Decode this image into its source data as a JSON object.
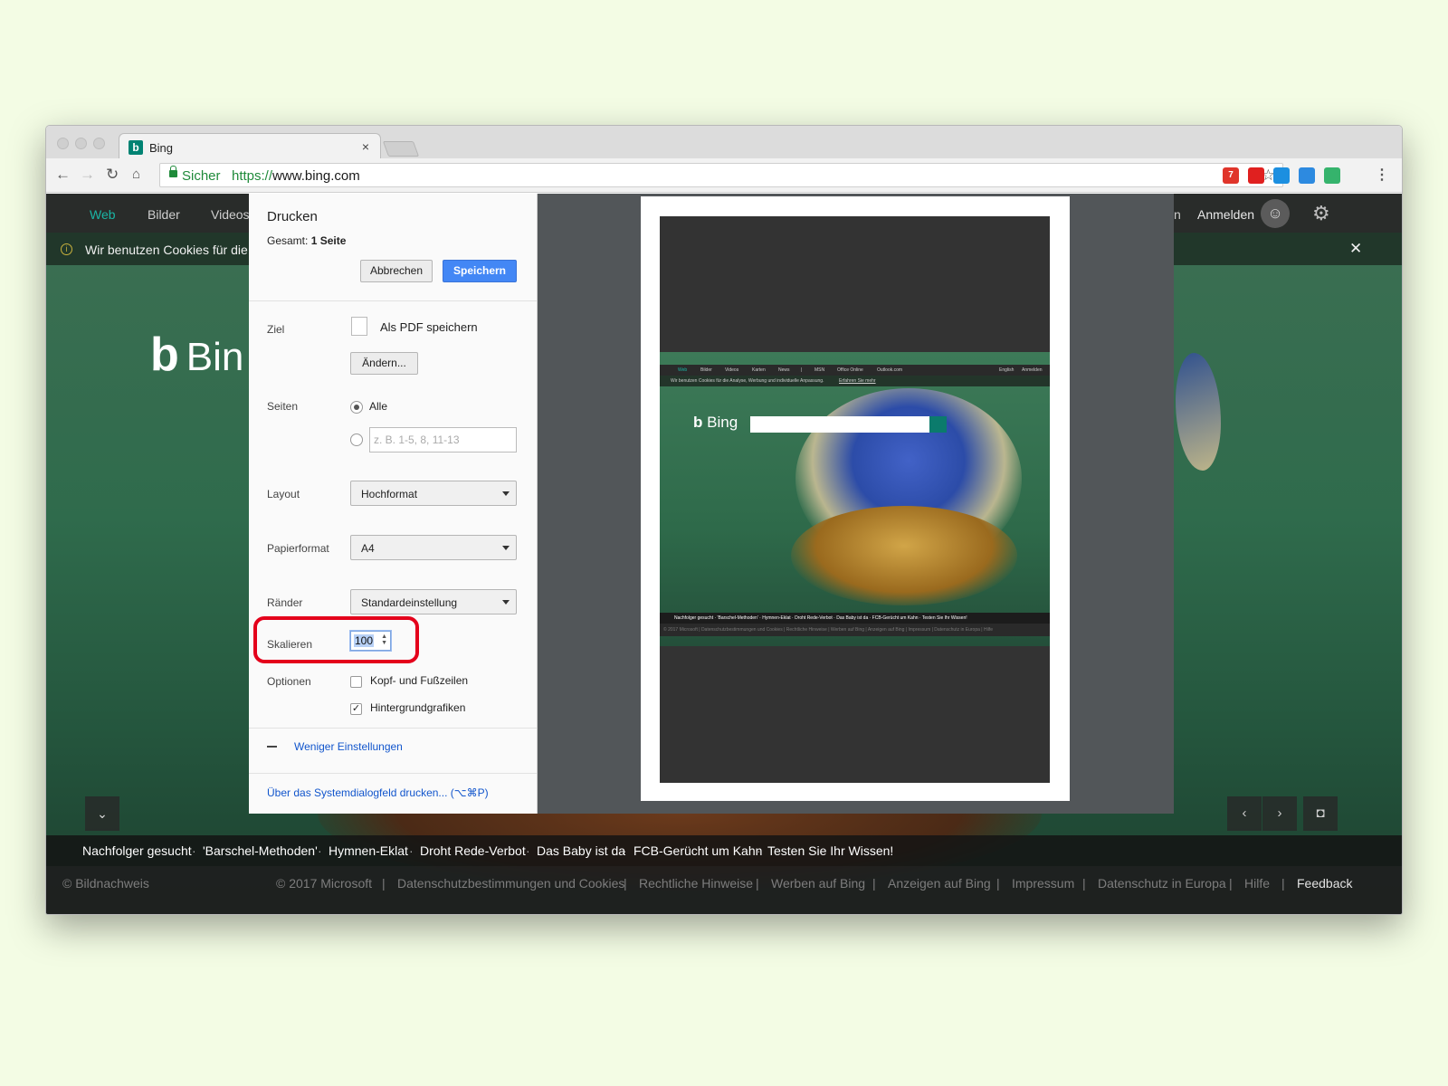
{
  "browser": {
    "tab_title": "Bing",
    "tab_close": "×",
    "secure_label": "Sicher",
    "url_scheme": "https://",
    "url_rest": "www.bing.com",
    "extensions": [
      {
        "name": "calendar-extension-icon",
        "color": "#e0352b",
        "badge": "7"
      },
      {
        "name": "opera-extension-icon",
        "color": "#e0201f"
      },
      {
        "name": "skype-extension-icon",
        "color": "#1c8fe0"
      },
      {
        "name": "plus-extension-icon",
        "color": "#2d8ae0"
      },
      {
        "name": "green-extension-icon",
        "color": "#35b36c"
      }
    ]
  },
  "bing": {
    "nav": [
      "Web",
      "Bilder",
      "Videos"
    ],
    "nav_right_fragment": "n",
    "signin": "Anmelden",
    "cookie_text": "Wir benutzen Cookies für die A",
    "cookie_close": "✕",
    "logo_text": "Bin",
    "headlines": [
      "Nachfolger gesucht",
      "'Barschel-Methoden'",
      "Hymnen-Eklat",
      "Droht Rede-Verbot",
      "Das Baby ist da",
      "FCB-Gerücht um Kahn",
      "Testen Sie Ihr Wissen!"
    ],
    "headline_sep": "·",
    "footer": {
      "credit": "© Bildnachweis",
      "items": [
        "© 2017 Microsoft",
        "Datenschutzbestimmungen und Cookies",
        "Rechtliche Hinweise",
        "Werben auf Bing",
        "Anzeigen auf Bing",
        "Impressum",
        "Datenschutz in Europa",
        "Hilfe",
        "Feedback"
      ],
      "sep": "|"
    },
    "accent_color": "#1ab5a5"
  },
  "print": {
    "title": "Drucken",
    "total_prefix": "Gesamt:",
    "total_value": "1 Seite",
    "cancel_label": "Abbrechen",
    "save_label": "Speichern",
    "destination_label": "Ziel",
    "destination_value": "Als PDF speichern",
    "change_label": "Ändern...",
    "pages_label": "Seiten",
    "pages_all": "Alle",
    "pages_placeholder": "z. B. 1-5, 8, 11-13",
    "layout_label": "Layout",
    "layout_value": "Hochformat",
    "paper_label": "Papierformat",
    "paper_value": "A4",
    "margins_label": "Ränder",
    "margins_value": "Standardeinstellung",
    "scale_label": "Skalieren",
    "scale_value": "100",
    "options_label": "Optionen",
    "option_headers": "Kopf- und Fußzeilen",
    "option_headers_checked": false,
    "option_backgrounds": "Hintergrundgrafiken",
    "option_backgrounds_checked": true,
    "less_settings": "Weniger Einstellungen",
    "system_dialog": "Über das Systemdialogfeld drucken... (⌥⌘P)",
    "highlight_color": "#e4001b",
    "primary_color": "#4387f5"
  },
  "preview": {
    "nav": [
      "Web",
      "Bilder",
      "Videos",
      "Karten",
      "News",
      "|",
      "MSN",
      "Office Online",
      "Outlook.com"
    ],
    "nav_right": [
      "English",
      "Anmelden"
    ],
    "cookie_text": "Wir benutzen Cookies für die Analyse, Werbung und individuelle Anpassung.",
    "cookie_link": "Erfahren Sie mehr",
    "logo": "Bing",
    "headlines": "Nachfolger gesucht · 'Barschel-Methoden' · Hymnen-Eklat · Droht Rede-Verbot · Das Baby ist da · FCB-Gerücht um Kahn · Testen Sie Ihr Wissen!",
    "footer": "© 2017 Microsoft | Datenschutzbestimmungen und Cookies | Rechtliche Hinweise | Werben auf Bing | Anzeigen auf Bing | Impressum | Datenschutz in Europa | Hilfe"
  }
}
